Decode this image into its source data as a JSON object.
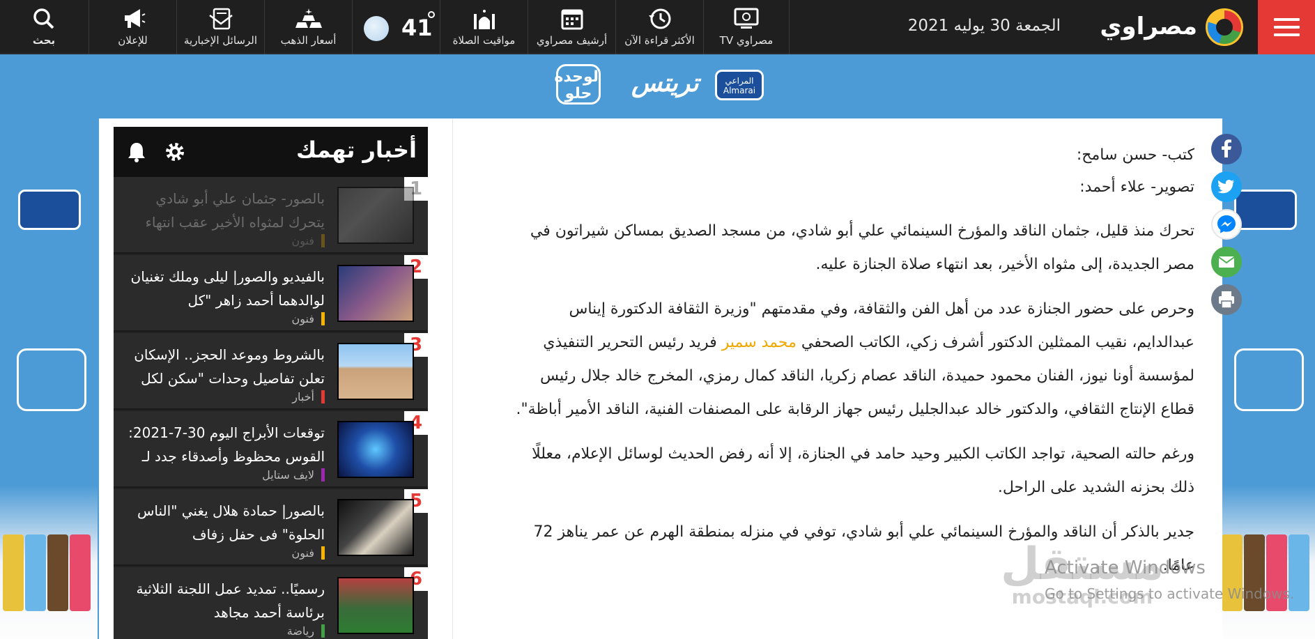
{
  "header": {
    "site_name": "مصراوي",
    "date": "الجمعة 30 يوليه 2021",
    "nav": [
      {
        "label": "مصراوي TV",
        "icon": "tv-icon"
      },
      {
        "label": "الأكثر قراءة الآن",
        "icon": "history-icon"
      },
      {
        "label": "أرشيف مصراوي",
        "icon": "calendar-icon"
      },
      {
        "label": "مواقيت الصلاة",
        "icon": "mosque-icon"
      },
      {
        "label": "أسعار الذهب",
        "icon": "gold-icon"
      },
      {
        "label": "الرسائل الإخبارية",
        "icon": "newsletter-icon"
      },
      {
        "label": "للإعلان",
        "icon": "megaphone-icon"
      },
      {
        "label": "بحث",
        "icon": "search-icon"
      }
    ],
    "weather": {
      "temperature": "41",
      "icon": "moon-icon"
    }
  },
  "ads": {
    "brand_badge": "المراعي Almarai",
    "brand_word": "تريتس",
    "slogan": "لوحده حلو"
  },
  "article": {
    "author": "كتب- حسن سامح:",
    "photographer": "تصوير- علاء أحمد:",
    "paragraphs": [
      "تحرك منذ قليل، جثمان الناقد والمؤرخ السينمائي علي أبو شادي، من مسجد الصديق بمساكن شيراتون في مصر الجديدة، إلى مثواه الأخير، بعد انتهاء صلاة الجنازة عليه.",
      "ورغم حالته الصحية، تواجد الكاتب الكبير وحيد حامد في الجنازة، إلا أنه رفض الحديث لوسائل الإعلام، معللًا ذلك بحزنه الشديد على الراحل.",
      "جدير بالذكر أن الناقد والمؤرخ السينمائي علي أبو شادي، توفي في منزله بمنطقة الهرم عن عمر يناهز 72 عامًا."
    ],
    "para2_part1": "وحرص على حضور الجنازة عدد من أهل الفن والثقافة، وفي مقدمتهم \"وزيرة الثقافة الدكتورة إيناس عبدالدايم، نقيب الممثلين الدكتور أشرف زكي، الكاتب الصحفي ",
    "para2_link": "محمد سمير",
    "para2_part2": " فريد رئيس التحرير التنفيذي لمؤسسة أونا نيوز، الفنان محمود حميدة، الناقد عصام زكريا، الناقد كمال رمزي، المخرج خالد جلال رئيس قطاع الإنتاج الثقافي، والدكتور خالد عبدالجليل رئيس جهاز الرقابة على المصنفات الفنية، الناقد الأمير أباظة\"."
  },
  "share": [
    "facebook-icon",
    "twitter-icon",
    "messenger-icon",
    "email-icon",
    "print-icon"
  ],
  "sidebar": {
    "title": "أخبار تهمك",
    "news": [
      {
        "num": "1",
        "title": "بالصور- جثمان علي أبو شادي يتحرك لمثواه الأخير عقب انتهاء",
        "category": "فنون",
        "cat_color": "#f5b400"
      },
      {
        "num": "2",
        "title": "بالفيديو والصور| ليلى وملك تغنيان لوالدهما أحمد زاهر \"كل",
        "category": "فنون",
        "cat_color": "#f5b400"
      },
      {
        "num": "3",
        "title": "بالشروط وموعد الحجز.. الإسكان تعلن تفاصيل وحدات \"سكن لكل",
        "category": "أخبار",
        "cat_color": "#e53935"
      },
      {
        "num": "4",
        "title": "توقعات الأبراج اليوم 30-7-2021: القوس محظوظ وأصدقاء جدد لـ",
        "category": "لايف ستايل",
        "cat_color": "#9c27b0"
      },
      {
        "num": "5",
        "title": "بالصور| حمادة هلال يغني \"الناس الحلوة\" فى حفل زفاف",
        "category": "فنون",
        "cat_color": "#f5b400"
      },
      {
        "num": "6",
        "title": "رسميًا.. تمديد عمل اللجنة الثلاثية برئاسة أحمد مجاهد",
        "category": "رياضة",
        "cat_color": "#43a047"
      }
    ]
  },
  "watermark": {
    "arabic": "مستقل",
    "latin": "mostaql.com"
  },
  "windows_notice": {
    "title": "Activate Windows",
    "subtitle": "Go to Settings to activate Windows."
  }
}
